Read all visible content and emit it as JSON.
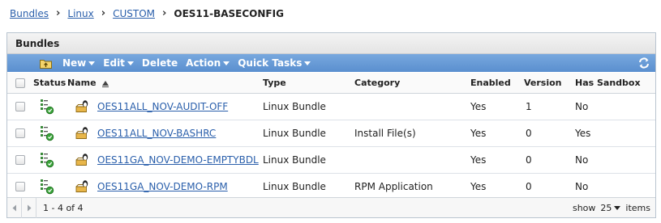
{
  "breadcrumb": {
    "items": [
      "Bundles",
      "Linux",
      "CUSTOM"
    ],
    "current": "OES11-BASECONFIG"
  },
  "panel": {
    "title": "Bundles"
  },
  "toolbar": {
    "new_label": "New",
    "edit_label": "Edit",
    "delete_label": "Delete",
    "action_label": "Action",
    "quick_tasks_label": "Quick Tasks"
  },
  "table": {
    "columns": {
      "status": "Status",
      "name": "Name",
      "type": "Type",
      "category": "Category",
      "enabled": "Enabled",
      "version": "Version",
      "sandbox": "Has Sandbox"
    },
    "rows": [
      {
        "name": "OES11ALL_NOV-AUDIT-OFF",
        "type": "Linux Bundle",
        "category": "",
        "enabled": "Yes",
        "version": "1",
        "sandbox": "No"
      },
      {
        "name": "OES11ALL_NOV-BASHRC",
        "type": "Linux Bundle",
        "category": "Install File(s)",
        "enabled": "Yes",
        "version": "0",
        "sandbox": "Yes"
      },
      {
        "name": "OES11GA_NOV-DEMO-EMPTYBDL",
        "type": "Linux Bundle",
        "category": "",
        "enabled": "Yes",
        "version": "0",
        "sandbox": "No"
      },
      {
        "name": "OES11GA_NOV-DEMO-RPM",
        "type": "Linux Bundle",
        "category": "RPM Application",
        "enabled": "Yes",
        "version": "0",
        "sandbox": "No"
      }
    ]
  },
  "footer": {
    "range": "1 - 4 of 4",
    "show_label": "show",
    "page_size": "25",
    "items_label": "items"
  },
  "colors": {
    "toolbar": "#6a9ad6",
    "link": "#2a5fab",
    "status_green": "#3aa33a"
  },
  "icons": {
    "toolbar_folder": "folder-up-icon",
    "refresh": "refresh-icon",
    "status": "status-ok-icon",
    "bundle": "linux-bundle-icon"
  }
}
